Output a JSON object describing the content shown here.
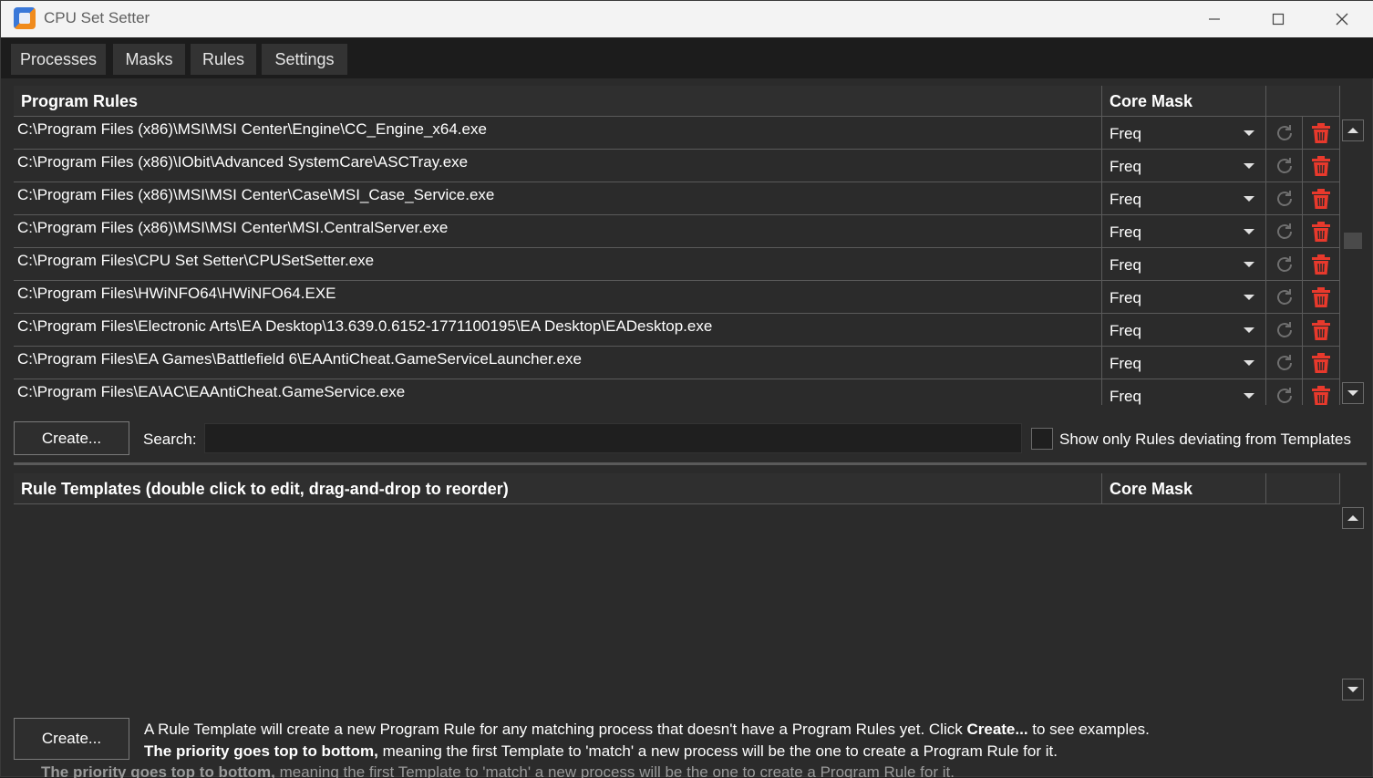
{
  "window": {
    "title": "CPU Set Setter"
  },
  "tabs": [
    {
      "label": "Processes"
    },
    {
      "label": "Masks"
    },
    {
      "label": "Rules"
    },
    {
      "label": "Settings"
    }
  ],
  "program_rules": {
    "header": {
      "title": "Program Rules",
      "core_mask": "Core Mask"
    },
    "rows": [
      {
        "path": "C:\\Program Files (x86)\\MSI\\MSI Center\\Engine\\CC_Engine_x64.exe",
        "mask": "Freq"
      },
      {
        "path": "C:\\Program Files (x86)\\IObit\\Advanced SystemCare\\ASCTray.exe",
        "mask": "Freq"
      },
      {
        "path": "C:\\Program Files (x86)\\MSI\\MSI Center\\Case\\MSI_Case_Service.exe",
        "mask": "Freq"
      },
      {
        "path": "C:\\Program Files (x86)\\MSI\\MSI Center\\MSI.CentralServer.exe",
        "mask": "Freq"
      },
      {
        "path": "C:\\Program Files\\CPU Set Setter\\CPUSetSetter.exe",
        "mask": "Freq"
      },
      {
        "path": "C:\\Program Files\\HWiNFO64\\HWiNFO64.EXE",
        "mask": "Freq"
      },
      {
        "path": "C:\\Program Files\\Electronic Arts\\EA Desktop\\13.639.0.6152-1771100195\\EA Desktop\\EADesktop.exe",
        "mask": "Freq"
      },
      {
        "path": "C:\\Program Files\\EA Games\\Battlefield 6\\EAAntiCheat.GameServiceLauncher.exe",
        "mask": "Freq"
      },
      {
        "path": "C:\\Program Files\\EA\\AC\\EAAntiCheat.GameService.exe",
        "mask": "Freq"
      }
    ],
    "scroll_position": 0.4
  },
  "controls": {
    "create_label": "Create...",
    "search_label": "Search:",
    "search_value": "",
    "show_only_label": "Show only Rules deviating from Templates",
    "show_only_checked": false
  },
  "rule_templates": {
    "header": {
      "title": "Rule Templates (double click to edit, drag-and-drop to reorder)",
      "core_mask": "Core Mask"
    },
    "rows": []
  },
  "footer": {
    "create_label": "Create...",
    "line1_a": "A Rule Template will create a new Program Rule for any matching process that doesn't have a Program Rules yet. Click ",
    "line1_bold": "Create...",
    "line1_b": " to see examples.",
    "line2_bold": "The priority goes top to bottom,",
    "line2_rest": " meaning the first Template to 'match' a new process will be the one to create a Program Rule for it."
  },
  "colors": {
    "delete_red": "#e8392c",
    "reset_gray": "#6f6f6f",
    "background": "#2b2b2b"
  }
}
